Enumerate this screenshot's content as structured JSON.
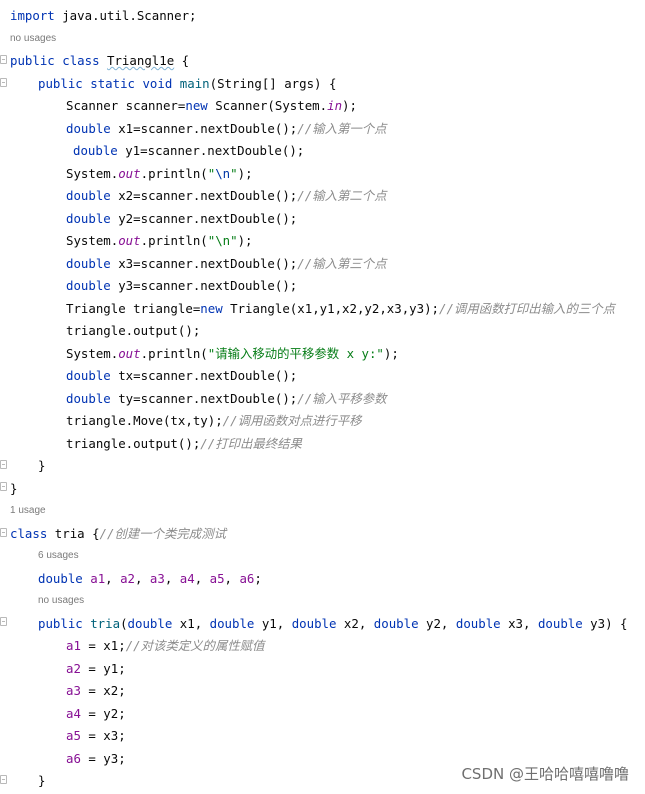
{
  "editor": {
    "language": "Java",
    "colors": {
      "keyword": "#0033b3",
      "string": "#067d17",
      "comment": "#8c8c8c",
      "field": "#871094",
      "method_decl": "#00627a",
      "text": "#080808",
      "hint": "#7a7a7a"
    }
  },
  "code": {
    "l01": {
      "kw": "import",
      "rest": " java.util.Scanner;"
    },
    "h01": "no usages",
    "l02": {
      "kw1": "public",
      "kw2": "class",
      "name": "Triangl1e",
      "rest": " {"
    },
    "l03": {
      "kw1": "public",
      "kw2": "static",
      "kw3": "void",
      "fn": "main",
      "rest": "(String[] args) {"
    },
    "l04": {
      "a": "Scanner scanner=",
      "kw": "new",
      "b": " Scanner(System.",
      "fld": "in",
      "c": ");"
    },
    "l05": {
      "kw": "double",
      "a": " x1=scanner.nextDouble();",
      "cmt": "//输入第一个点"
    },
    "l06": {
      "kw": "double",
      "a": " y1=scanner.nextDouble();"
    },
    "l07": {
      "a": "System.",
      "fld": "out",
      "b": ".println(",
      "q1": "\"",
      "esc": "\\n",
      "q2": "\"",
      "c": ");"
    },
    "l08": {
      "kw": "double",
      "a": " x2=scanner.nextDouble();",
      "cmt": "//输入第二个点"
    },
    "l09": {
      "kw": "double",
      "a": " y2=scanner.nextDouble();"
    },
    "l10": {
      "a": "System.",
      "fld": "out",
      "b": ".println(",
      "str": "\"\\n\"",
      "c": ");"
    },
    "l11": {
      "kw": "double",
      "a": " x3=scanner.nextDouble();",
      "cmt": "//输入第三个点"
    },
    "l12": {
      "kw": "double",
      "a": " y3=scanner.nextDouble();"
    },
    "l13": {
      "a": "Triangle triangle=",
      "kw": "new",
      "b": " Triangle(x1,y1,x2,y2,x3,y3);",
      "cmt": "//调用函数打印出输入的三个点"
    },
    "l14": {
      "a": "triangle.output();"
    },
    "l15": {
      "a": "System.",
      "fld": "out",
      "b": ".println(",
      "str": "\"请输入移动的平移参数 x y:\"",
      "c": ");"
    },
    "l16": {
      "kw": "double",
      "a": " tx=scanner.nextDouble();"
    },
    "l17": {
      "kw": "double",
      "a": " ty=scanner.nextDouble();",
      "cmt": "//输入平移参数"
    },
    "l18": {
      "a": "triangle.Move(tx,ty);",
      "cmt": "//调用函数对点进行平移"
    },
    "l19": {
      "a": "triangle.output();",
      "cmt": "//打印出最终结果"
    },
    "l20": {
      "a": "}"
    },
    "l21": {
      "a": "}"
    },
    "h02": "1 usage",
    "l22": {
      "kw": "class",
      "name": " tria",
      "a": " {",
      "cmt": "//创建一个类完成测试"
    },
    "h03": "6 usages",
    "l23": {
      "kw": "double",
      "f1": "a1",
      "s1": ", ",
      "f2": "a2",
      "s2": ", ",
      "f3": "a3",
      "s3": ", ",
      "f4": "a4",
      "s4": ", ",
      "f5": "a5",
      "s5": ", ",
      "f6": "a6",
      "end": ";"
    },
    "h04": "no usages",
    "l24": {
      "kw": "public",
      "fn": " tria",
      "p0": "(",
      "k1": "double",
      "p1": " x1, ",
      "k2": "double",
      "p2": " y1, ",
      "k3": "double",
      "p3": " x2, ",
      "k4": "double",
      "p4": " y2, ",
      "k5": "double",
      "p5": " x3, ",
      "k6": "double",
      "p6": " y3) {"
    },
    "l25": {
      "f": "a1",
      "a": " = x1;",
      "cmt": "//对该类定义的属性赋值"
    },
    "l26": {
      "f": "a2",
      "a": " = y1;"
    },
    "l27": {
      "f": "a3",
      "a": " = x2;"
    },
    "l28": {
      "f": "a4",
      "a": " = y2;"
    },
    "l29": {
      "f": "a5",
      "a": " = x3;"
    },
    "l30": {
      "f": "a6",
      "a": " = y3;"
    },
    "l31": {
      "a": "}"
    }
  },
  "watermark": "CSDN @王哈哈嘻嘻噜噜"
}
